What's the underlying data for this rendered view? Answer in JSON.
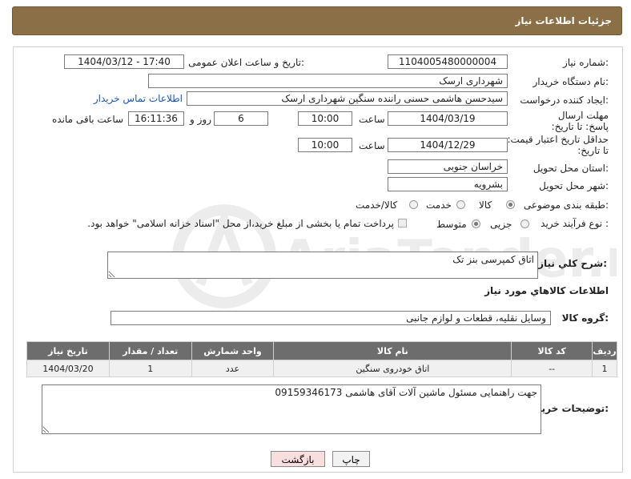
{
  "header": {
    "title": "جزئیات اطلاعات نیاز"
  },
  "fields": {
    "need_number_label": "شماره نیاز:",
    "need_number": "1104005480000004",
    "announce_label": "تاریخ و ساعت اعلان عمومی:",
    "announce_value": "1404/03/12 - 17:40",
    "buyer_org_label": "نام دستگاه خریدار:",
    "buyer_org": "شهرداری ارسک",
    "creator_label": "ایجاد کننده درخواست:",
    "creator": "سیدحسن هاشمی حسنی راننده سنگین شهرداری ارسک",
    "contact_link": "اطلاعات تماس خریدار",
    "reply_deadline_label": "مهلت ارسال پاسخ: تا تاریخ:",
    "reply_date": "1404/03/19",
    "time_label": "ساعت",
    "reply_time": "10:00",
    "days_value": "6",
    "days_label": "روز و",
    "remaining_time": "16:11:36",
    "remaining_label": "ساعت باقی مانده",
    "price_validity_label": "حداقل تاریخ اعتبار قیمت: تا تاریخ:",
    "price_date": "1404/12/29",
    "price_time_label": "ساعت",
    "price_time": "10:00",
    "province_label": "استان محل تحویل:",
    "province": "خراسان جنوبی",
    "city_label": "شهر محل تحویل:",
    "city": "بشرویه",
    "category_label": "طبقه بندی موضوعی:",
    "cat_goods": "کالا",
    "cat_service": "خدمت",
    "cat_both": "کالا/خدمت",
    "process_label": "نوع فرآیند خرید :",
    "proc_partial": "جزیی",
    "proc_medium": "متوسط",
    "payment_note": "پرداخت تمام یا بخشی از مبلغ خرید،از محل \"اسناد خزانه اسلامی\" خواهد بود.",
    "desc_label": "شرح کلي نياز:",
    "desc_value": "اتاق کمپرسی بنز تک",
    "goods_info_title": "اطلاعات کالاهاي مورد نياز",
    "goods_group_label": "گروه کالا:",
    "goods_group": "وسایل نقلیه، قطعات و لوازم جانبی",
    "buyer_notes_label": "توضیحات خریدار:",
    "buyer_notes": "جهت راهنمایی مسئول ماشین آلات آقای هاشمی 09159346173"
  },
  "table": {
    "headers": [
      "ردیف",
      "کد کالا",
      "نام کالا",
      "واحد شمارش",
      "تعداد / مقدار",
      "تاریخ نیاز"
    ],
    "rows": [
      [
        "1",
        "--",
        "اتاق خودروی سنگین",
        "عدد",
        "1",
        "1404/03/20"
      ]
    ]
  },
  "buttons": {
    "print": "چاپ",
    "back": "بازگشت"
  },
  "watermark": "AriaTender.net",
  "colors": {
    "header_bg": "#8b6f46",
    "table_header_bg": "#6d6d6d",
    "back_button_bg": "#f9dede",
    "link": "#1b57b8"
  }
}
